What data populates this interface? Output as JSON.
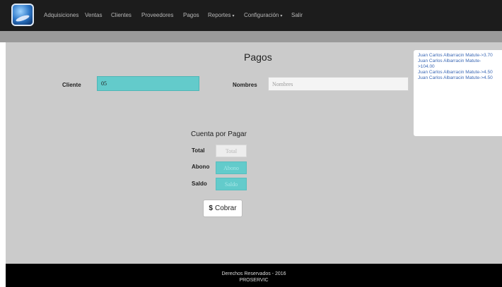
{
  "navbar": {
    "logo_icon": "globe-logo-icon",
    "items": [
      {
        "label": "Adquisiciones"
      },
      {
        "label": "Ventas"
      },
      {
        "label": "Clientes"
      },
      {
        "label": "Proveedores"
      },
      {
        "label": "Pagos"
      },
      {
        "label": "Reportes"
      },
      {
        "label": "Configuración"
      },
      {
        "label": "Salir"
      }
    ]
  },
  "page": {
    "title": "Pagos"
  },
  "form": {
    "cliente_label": "Cliente",
    "cliente_value": "05",
    "nombres_label": "Nombres",
    "nombres_placeholder": "Nombres"
  },
  "cuenta": {
    "title": "Cuenta por Pagar",
    "total_label": "Total",
    "total_placeholder": "Total",
    "abono_label": "Abono",
    "abono_placeholder": "Abono",
    "saldo_label": "Saldo",
    "saldo_placeholder": "Saldo",
    "button_icon": "dollar-icon",
    "button_symbol": "$",
    "button_label": "Cobrar"
  },
  "results": [
    {
      "line1": "Juan Carlos Albarracin Matute->3.70",
      "line2": ""
    },
    {
      "line1": "Juan Carlos Albarracin Matute-",
      "line2": ">104.00"
    },
    {
      "line1": "Juan Carlos Albarracin Matute->4.50",
      "line2": ""
    },
    {
      "line1": "Juan Carlos Albarracin Matute->4.50",
      "line2": ""
    }
  ],
  "footer": {
    "line1": "Derechos Reservados - 2016",
    "line2": "PROSERVIC"
  },
  "colors": {
    "navbar": "#1c1c1c",
    "content_bg": "#cbcbcb",
    "teal_field": "#63cbcb",
    "link": "#3b68b5"
  }
}
